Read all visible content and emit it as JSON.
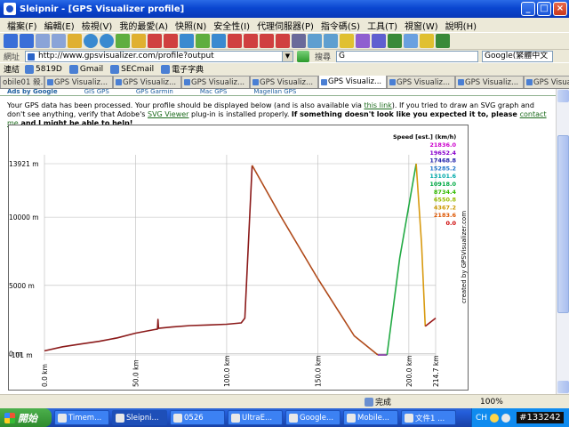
{
  "window": {
    "title": "Sleipnir - [GPS Visualizer profile]"
  },
  "menu": [
    "檔案(F)",
    "編輯(E)",
    "檢視(V)",
    "我的最愛(A)",
    "快照(N)",
    "安全性(I)",
    "代理伺服器(P)",
    "指令碼(S)",
    "工具(T)",
    "視窗(W)",
    "說明(H)"
  ],
  "address": {
    "label": "網址",
    "value": "http://www.gpsvisualizer.com/profile?output"
  },
  "search": {
    "label": "搜尋",
    "value": "G",
    "engine": "Google(繁體中文"
  },
  "links": {
    "label": "連結",
    "items": [
      "5819D",
      "Gmail",
      "SECmail",
      "電子字典"
    ]
  },
  "tabs": [
    "obile01 殺...",
    "GPS Visualiz...",
    "GPS Visualiz...",
    "GPS Visualiz...",
    "GPS Visualiz...",
    "GPS Visualiz...",
    "GPS Visualiz...",
    "GPS Visualiz...",
    "GPS Visualiz..."
  ],
  "active_tab": 5,
  "ads": [
    "Ads by Google",
    "GIS GPS",
    "GPS Garmin",
    "Mac GPS",
    "Magellan GPS"
  ],
  "notice": {
    "p1": "Your GPS data has been processed. Your profile should be displayed below (and is also available via ",
    "link1": "this link",
    "p2": "). If you tried to draw an SVG graph and don't see anything, verify that Adobe's ",
    "link2": "SVG Viewer",
    "p3": " plug-in is installed properly. ",
    "bold": "If something doesn't look like you expected it to, please ",
    "link3": "contact me",
    "bold2": " and I might be able to help!"
  },
  "chart_data": {
    "type": "line",
    "credit": "created by GPSVisualizer.com",
    "y_unit": "m",
    "x_unit": "km",
    "ylim": [
      -101,
      13921
    ],
    "xlim": [
      0.0,
      214.7
    ],
    "y_ticks": [
      {
        "value": 13921,
        "label": "13921 m"
      },
      {
        "value": 10000,
        "label": "10000 m"
      },
      {
        "value": 5000,
        "label": "5000 m"
      },
      {
        "value": 0,
        "label": "0 m"
      },
      {
        "value": -101,
        "label": "-101 m"
      }
    ],
    "x_ticks": [
      {
        "value": 0.0,
        "label": "0.0 km"
      },
      {
        "value": 50.0,
        "label": "50.0 km"
      },
      {
        "value": 100.0,
        "label": "100.0 km"
      },
      {
        "value": 150.0,
        "label": "150.0 km"
      },
      {
        "value": 200.0,
        "label": "200.0 km"
      },
      {
        "value": 214.7,
        "label": "214.7 km"
      }
    ],
    "grid": true,
    "legend": {
      "title": "Speed [est.] (km/h)",
      "placement": "top-right",
      "entries": [
        {
          "label": "21836.0",
          "color": "#cc00cc"
        },
        {
          "label": "19652.4",
          "color": "#8800cc"
        },
        {
          "label": "17468.8",
          "color": "#2222aa"
        },
        {
          "label": "15285.2",
          "color": "#2277cc"
        },
        {
          "label": "13101.6",
          "color": "#00aaaa"
        },
        {
          "label": "10918.0",
          "color": "#00aa44"
        },
        {
          "label": "8734.4",
          "color": "#33bb00"
        },
        {
          "label": "6550.8",
          "color": "#99bb00"
        },
        {
          "label": "4367.2",
          "color": "#cc9900"
        },
        {
          "label": "2183.6",
          "color": "#dd5500"
        },
        {
          "label": "0.0",
          "color": "#cc0000"
        }
      ]
    },
    "series": [
      {
        "color": "#8b1a1a",
        "points": [
          [
            0,
            200
          ],
          [
            10,
            500
          ],
          [
            20,
            700
          ],
          [
            30,
            900
          ],
          [
            40,
            1150
          ],
          [
            50,
            1500
          ],
          [
            60,
            1750
          ],
          [
            62,
            1800
          ],
          [
            62.3,
            2500
          ],
          [
            62.6,
            1850
          ],
          [
            70,
            1950
          ],
          [
            80,
            2050
          ],
          [
            90,
            2100
          ],
          [
            100,
            2150
          ],
          [
            108,
            2250
          ],
          [
            110,
            2600
          ],
          [
            114,
            13800
          ]
        ]
      },
      {
        "color": "#b04a1a",
        "points": [
          [
            114,
            13800
          ],
          [
            130,
            10000
          ],
          [
            150,
            5500
          ],
          [
            170,
            1300
          ],
          [
            183,
            -101
          ]
        ]
      },
      {
        "color": "#7a2a9a",
        "points": [
          [
            183,
            -101
          ],
          [
            188,
            -101
          ]
        ]
      },
      {
        "color": "#22aa44",
        "points": [
          [
            188,
            -101
          ],
          [
            195,
            7000
          ],
          [
            204,
            13921
          ]
        ]
      },
      {
        "color": "#d89a10",
        "points": [
          [
            204,
            13921
          ],
          [
            207,
            8000
          ],
          [
            209,
            2000
          ]
        ]
      },
      {
        "color": "#9b1a1a",
        "points": [
          [
            209,
            2000
          ],
          [
            214.7,
            2600
          ]
        ]
      }
    ]
  },
  "status": {
    "text": "完成",
    "zoom": "100%"
  },
  "taskbar": {
    "start": "開始",
    "tasks": [
      "Timem...",
      "Sleipni...",
      "0526",
      "UltraE...",
      "Google...",
      "Mobile...",
      "文件1 ..."
    ],
    "active_task": 1,
    "lang": "CH",
    "code": "#133242"
  }
}
